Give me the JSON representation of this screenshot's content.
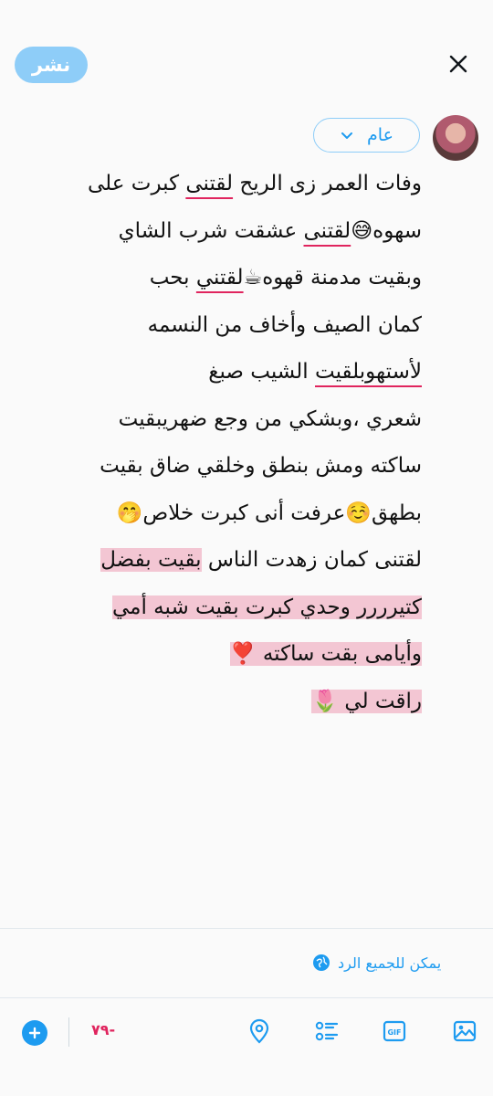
{
  "header": {
    "post_label": "نشر"
  },
  "audience": {
    "label": "عام"
  },
  "compose": {
    "lines": [
      {
        "parts": [
          {
            "t": "وفات العمر زى الريح "
          },
          {
            "t": "لقتنى",
            "u": true
          },
          {
            "t": " كبرت على"
          }
        ]
      },
      {
        "parts": [
          {
            "t": "سهوه😅"
          },
          {
            "t": "لقتنى",
            "u": true
          },
          {
            "t": " عشقت شرب الشاي"
          }
        ]
      },
      {
        "parts": [
          {
            "t": "وبقيت مدمنة قهوه☕"
          },
          {
            "t": "لقتني",
            "u": true
          },
          {
            "t": " بحب"
          }
        ]
      },
      {
        "parts": [
          {
            "t": "كمان الصيف وأخاف من النسمه"
          }
        ]
      },
      {
        "parts": [
          {
            "t": "لأستهوبلقيت",
            "u": true
          },
          {
            "t": " الشيب صبغ"
          }
        ]
      },
      {
        "parts": [
          {
            "t": "شعري ،وبشكي من وجع ضهريبقيت"
          }
        ]
      },
      {
        "parts": [
          {
            "t": "ساكته ومش بنطق وخلقي ضاق بقيت"
          }
        ]
      },
      {
        "parts": [
          {
            "t": "بطهق☺️عرفت أنى كبرت خلاص🤭"
          }
        ]
      },
      {
        "parts": [
          {
            "t": "لقتنى كمان زهدت الناس "
          },
          {
            "t": "بقيت بفضل",
            "h": true
          }
        ]
      },
      {
        "parts": [
          {
            "t": "كتيرررر وحدي كبرت بقيت شبه أمي",
            "h": true
          }
        ]
      },
      {
        "parts": [
          {
            "t": "وأيامى بقت ساكته ❣️",
            "h": true
          }
        ]
      },
      {
        "parts": [
          {
            "t": "راقت لي 🌷",
            "h": true
          }
        ]
      }
    ]
  },
  "reply_setting": {
    "label": "يمكن للجميع الرد"
  },
  "toolbar": {
    "counter": "-٧٩"
  },
  "colors": {
    "accent": "#1d9bf0",
    "post_disabled": "#8ecdf8",
    "counter": "#e0245e",
    "highlight": "#f3c6d3"
  },
  "icons": [
    "close-icon",
    "chevron-down-icon",
    "globe-icon",
    "image-icon",
    "gif-icon",
    "poll-icon",
    "location-icon",
    "add-icon"
  ]
}
